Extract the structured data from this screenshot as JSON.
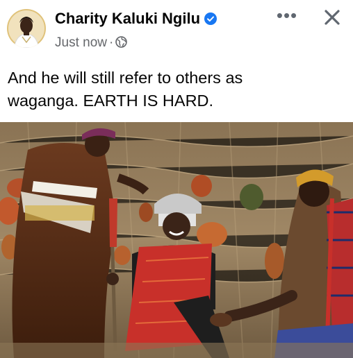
{
  "post": {
    "author": "Charity Kaluki Ngilu",
    "timestamp": "Just now",
    "separator": "·",
    "more_label": "•••",
    "text_line1": "And he will still refer to others as",
    "text_line2": "waganga. EARTH IS HARD."
  },
  "icons": {
    "verified": "verified-badge-icon",
    "audience": "globe-icon",
    "more": "more-options-icon",
    "close": "close-icon"
  },
  "colors": {
    "verified_blue": "#1877f2",
    "meta_gray": "#65676b",
    "text": "#050505"
  }
}
